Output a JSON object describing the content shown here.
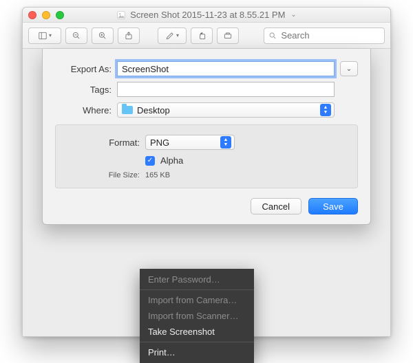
{
  "window": {
    "title": "Screen Shot 2015-11-23 at 8.55.21 PM"
  },
  "toolbar": {
    "search_placeholder": "Search"
  },
  "export": {
    "export_as_label": "Export As:",
    "export_as_value": "ScreenShot",
    "tags_label": "Tags:",
    "tags_value": "",
    "where_label": "Where:",
    "where_value": "Desktop",
    "format_label": "Format:",
    "format_value": "PNG",
    "alpha_label": "Alpha",
    "alpha_checked": true,
    "filesize_label": "File Size:",
    "filesize_value": "165 KB",
    "cancel": "Cancel",
    "save": "Save"
  },
  "menu": {
    "items": [
      "Enter Password…",
      "Import from Camera…",
      "Import from Scanner…",
      "Take Screenshot",
      "Print…"
    ]
  }
}
